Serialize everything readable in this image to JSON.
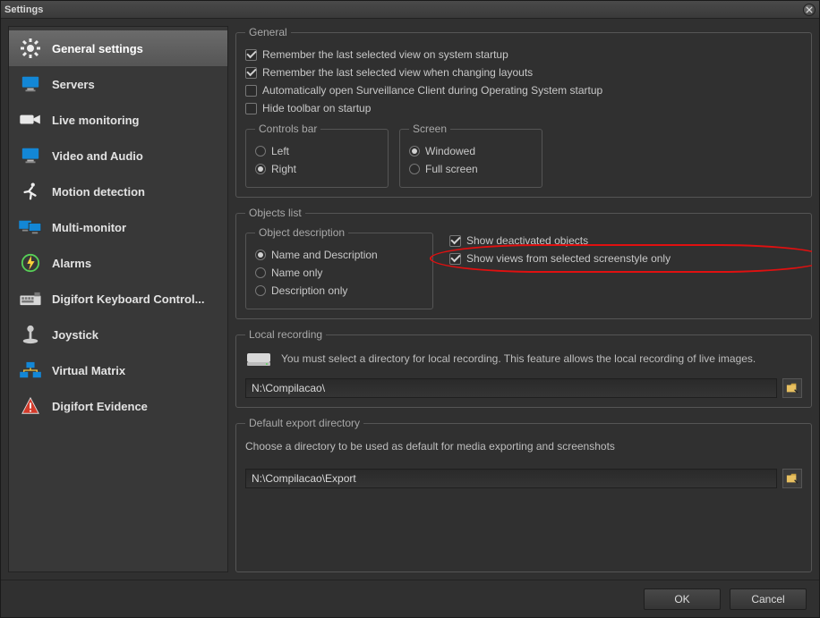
{
  "window": {
    "title": "Settings"
  },
  "sidebar": {
    "items": [
      {
        "label": "General settings"
      },
      {
        "label": "Servers"
      },
      {
        "label": "Live monitoring"
      },
      {
        "label": "Video and Audio"
      },
      {
        "label": "Motion detection"
      },
      {
        "label": "Multi-monitor"
      },
      {
        "label": "Alarms"
      },
      {
        "label": "Digifort Keyboard Control..."
      },
      {
        "label": "Joystick"
      },
      {
        "label": "Virtual Matrix"
      },
      {
        "label": "Digifort Evidence"
      }
    ],
    "active_index": 0
  },
  "general": {
    "legend": "General",
    "remember_startup": "Remember the last selected view on system startup",
    "remember_layouts": "Remember the last selected view when changing layouts",
    "auto_open_client": "Automatically open Surveillance Client during Operating System startup",
    "hide_toolbar": "Hide toolbar on startup",
    "controls_bar": {
      "legend": "Controls bar",
      "left": "Left",
      "right": "Right",
      "selected": "right"
    },
    "screen": {
      "legend": "Screen",
      "windowed": "Windowed",
      "fullscreen": "Full screen",
      "selected": "windowed"
    },
    "checks": {
      "remember_startup": true,
      "remember_layouts": true,
      "auto_open_client": false,
      "hide_toolbar": false
    }
  },
  "objects": {
    "legend": "Objects list",
    "desc": {
      "legend": "Object description",
      "name_and_desc": "Name and Description",
      "name_only": "Name only",
      "desc_only": "Description only",
      "selected": "name_and_desc"
    },
    "show_deactivated": "Show deactivated objects",
    "show_views_selected_style": "Show views from selected screenstyle only",
    "checks": {
      "show_deactivated": true,
      "show_views_selected_style": true
    }
  },
  "local_recording": {
    "legend": "Local recording",
    "info": "You must select a directory for local recording. This feature allows the local recording of live images.",
    "path": "N:\\Compilacao\\"
  },
  "export_dir": {
    "legend": "Default export directory",
    "info": "Choose a directory to be used as default for media exporting and screenshots",
    "path": "N:\\Compilacao\\Export"
  },
  "buttons": {
    "ok": "OK",
    "cancel": "Cancel"
  }
}
